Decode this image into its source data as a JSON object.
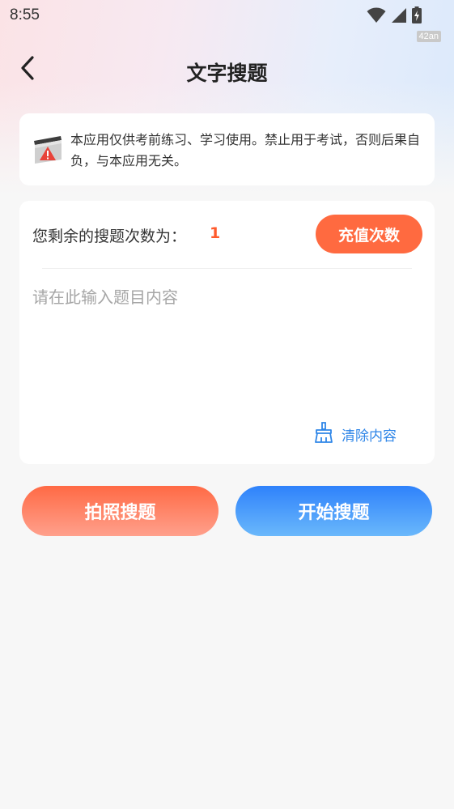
{
  "status_bar": {
    "time": "8:55",
    "watermark": "42an"
  },
  "nav": {
    "title": "文字搜题"
  },
  "notice": {
    "text": "本应用仅供考前练习、学习使用。禁止用于考试，否则后果自负，与本应用无关。"
  },
  "main": {
    "remain_label": "您剩余的搜题次数为：",
    "remain_count": "1",
    "recharge_label": "充值次数",
    "input_value": "",
    "input_placeholder": "请在此输入题目内容",
    "clear_label": "清除内容"
  },
  "actions": {
    "photo_label": "拍照搜题",
    "start_label": "开始搜题"
  },
  "colors": {
    "accent_orange": "#ff6a40",
    "accent_blue": "#2f86e8",
    "count_color": "#ff5a2c"
  },
  "icons": {
    "back": "back-arrow-icon",
    "notice": "warning-sign-icon",
    "clear": "broom-icon",
    "wifi": "wifi-icon",
    "signal": "signal-icon",
    "battery": "battery-charging-icon"
  }
}
